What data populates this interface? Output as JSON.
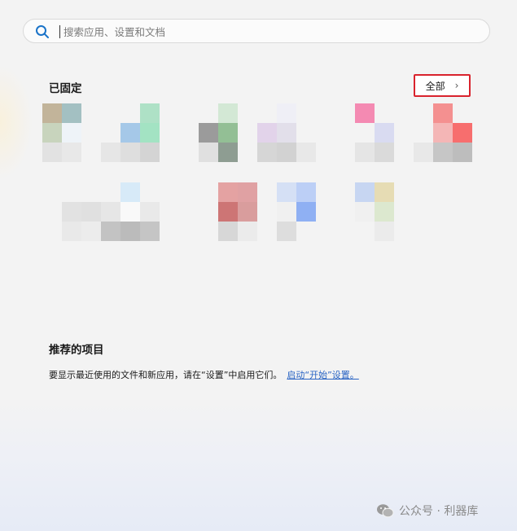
{
  "search": {
    "placeholder": "搜索应用、设置和文档",
    "value": ""
  },
  "pinned": {
    "title": "已固定",
    "all_button": {
      "label": "全部",
      "chevron": "chevron-right-icon"
    },
    "apps": [
      {
        "cells": [
          [
            "#c2b49a",
            "#a3c0c2",
            "#f3f3f3"
          ],
          [
            "#c8d4bd",
            "#eef3f8",
            "#f3f3f3"
          ],
          [
            "#e2e2e2",
            "#e8e8e8",
            "#f3f3f3"
          ]
        ]
      },
      {
        "cells": [
          [
            "#f3f3f3",
            "#f3f3f3",
            "#aee1c6"
          ],
          [
            "#f3f3f3",
            "#a5c8e8",
            "#a3e3c3"
          ],
          [
            "#e6e6e6",
            "#dedede",
            "#d4d4d4"
          ]
        ]
      },
      {
        "cells": [
          [
            "#f3f3f3",
            "#d3e8d5",
            "#f3f3f3"
          ],
          [
            "#9b9b9b",
            "#93bf95",
            "#f3f3f3"
          ],
          [
            "#e0e0e0",
            "#8e9d92",
            "#f3f3f3"
          ]
        ]
      },
      {
        "cells": [
          [
            "#f3f3f3",
            "#efeff6",
            "#f3f3f3"
          ],
          [
            "#e2d3ea",
            "#e2dfea",
            "#f3f3f3"
          ],
          [
            "#d6d6d6",
            "#d2d2d2",
            "#e8e8e8"
          ]
        ]
      },
      {
        "cells": [
          [
            "#f3f3f3",
            "#f48ab2",
            "#f3f3f3"
          ],
          [
            "#f3f3f3",
            "#f3f3f3",
            "#d9dbf1"
          ],
          [
            "#f3f3f3",
            "#e5e5e5",
            "#dadada"
          ]
        ]
      },
      {
        "cells": [
          [
            "#f3f3f3",
            "#f49090",
            "#f3f3f3"
          ],
          [
            "#f3f3f3",
            "#f4b6b6",
            "#f76e6e"
          ],
          [
            "#e8e8e8",
            "#c6c6c6",
            "#bdbdbd"
          ]
        ]
      },
      {
        "cells": [
          [
            "#f3f3f3",
            "#f3f3f3",
            "#f3f3f3"
          ],
          [
            "#f3f3f3",
            "#e2e2e2",
            "#e0e0e0"
          ],
          [
            "#f3f3f3",
            "#e9e9e9",
            "#ececec"
          ]
        ]
      },
      {
        "cells": [
          [
            "#f3f3f3",
            "#d7eaf8",
            "#f3f3f3"
          ],
          [
            "#e6e6e6",
            "#f9f9f9",
            "#e9e9e9"
          ],
          [
            "#c3c3c3",
            "#bbbbbb",
            "#c5c5c5"
          ]
        ]
      },
      {
        "cells": [
          [
            "#f3f3f3",
            "#e4a2a2",
            "#e0a1a3"
          ],
          [
            "#f3f3f3",
            "#cd7575",
            "#d99d9d"
          ],
          [
            "#f3f3f3",
            "#d7d7d7",
            "#ebebeb"
          ]
        ]
      },
      {
        "cells": [
          [
            "#f3f3f3",
            "#d5e0f5",
            "#bccff6"
          ],
          [
            "#f3f3f3",
            "#f0f0f0",
            "#8fb0f3"
          ],
          [
            "#f3f3f3",
            "#dddddd",
            "#f3f3f3"
          ]
        ]
      },
      {
        "cells": [
          [
            "#f3f3f3",
            "#c7d6f2",
            "#e6dcb4"
          ],
          [
            "#f3f3f3",
            "#f0f0f0",
            "#dce8cf"
          ],
          [
            "#f3f3f3",
            "#f3f3f3",
            "#ebebeb"
          ]
        ]
      }
    ]
  },
  "recommended": {
    "title": "推荐的项目",
    "text": "要显示最近使用的文件和新应用，请在“设置”中启用它们。",
    "link": "启动“开始”设置。"
  },
  "watermark": {
    "text": "公众号 · 利器库",
    "icon": "wechat-icon"
  },
  "colors": {
    "highlight_border": "#d9232d",
    "link": "#2a64c4",
    "search_icon": "#1a73c8"
  }
}
